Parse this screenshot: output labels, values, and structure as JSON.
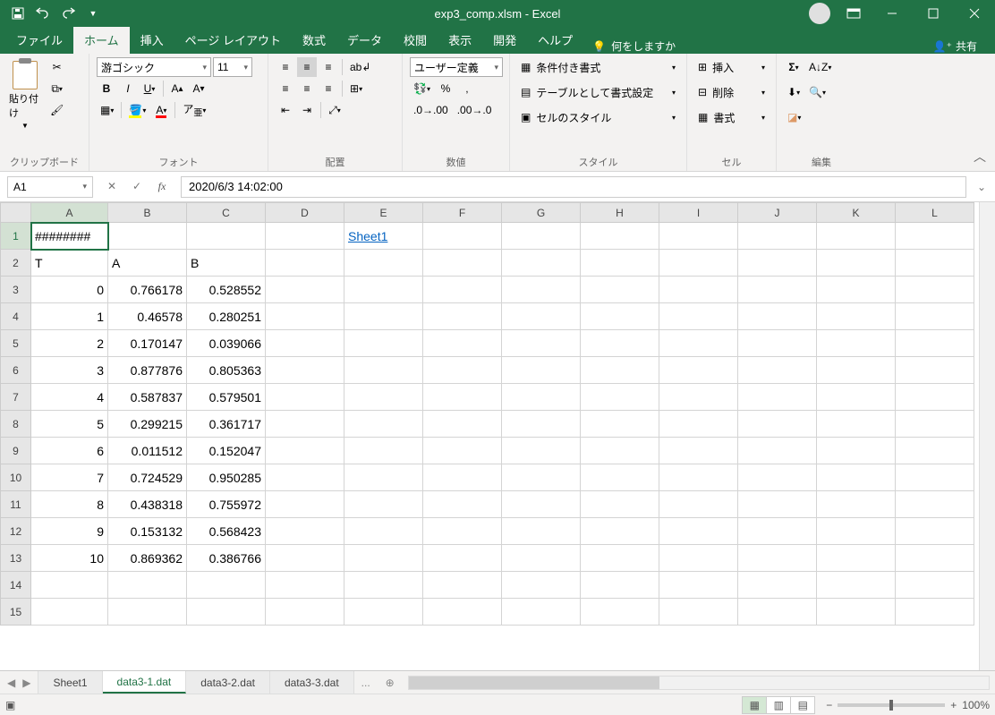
{
  "titlebar": {
    "title": "exp3_comp.xlsm  -  Excel"
  },
  "tabs": {
    "file": "ファイル",
    "home": "ホーム",
    "insert": "挿入",
    "pagelayout": "ページ レイアウト",
    "formulas": "数式",
    "data": "データ",
    "review": "校閲",
    "view": "表示",
    "developer": "開発",
    "help": "ヘルプ",
    "tellme": "何をしますか",
    "share": "共有"
  },
  "ribbon": {
    "clipboard": {
      "label": "クリップボード",
      "paste": "貼り付け"
    },
    "font": {
      "label": "フォント",
      "name": "游ゴシック",
      "size": "11"
    },
    "alignment": {
      "label": "配置"
    },
    "number": {
      "label": "数値",
      "format": "ユーザー定義"
    },
    "styles": {
      "label": "スタイル",
      "cond": "条件付き書式",
      "table": "テーブルとして書式設定",
      "cell": "セルのスタイル"
    },
    "cells": {
      "label": "セル",
      "insert": "挿入",
      "delete": "削除",
      "format": "書式"
    },
    "editing": {
      "label": "編集"
    }
  },
  "namebox": "A1",
  "formula": "2020/6/3 14:02:00",
  "columns": [
    "A",
    "B",
    "C",
    "D",
    "E",
    "F",
    "G",
    "H",
    "I",
    "J",
    "K",
    "L"
  ],
  "rows": [
    "1",
    "2",
    "3",
    "4",
    "5",
    "6",
    "7",
    "8",
    "9",
    "10",
    "11",
    "12",
    "13",
    "14",
    "15"
  ],
  "cells": {
    "A1": "########",
    "E1": "Sheet1",
    "A2": "T",
    "B2": "A",
    "C2": "B",
    "A3": "0",
    "B3": "0.766178",
    "C3": "0.528552",
    "A4": "1",
    "B4": "0.46578",
    "C4": "0.280251",
    "A5": "2",
    "B5": "0.170147",
    "C5": "0.039066",
    "A6": "3",
    "B6": "0.877876",
    "C6": "0.805363",
    "A7": "4",
    "B7": "0.587837",
    "C7": "0.579501",
    "A8": "5",
    "B8": "0.299215",
    "C8": "0.361717",
    "A9": "6",
    "B9": "0.011512",
    "C9": "0.152047",
    "A10": "7",
    "B10": "0.724529",
    "C10": "0.950285",
    "A11": "8",
    "B11": "0.438318",
    "C11": "0.755972",
    "A12": "9",
    "B12": "0.153132",
    "C12": "0.568423",
    "A13": "10",
    "B13": "0.869362",
    "C13": "0.386766"
  },
  "sheets": {
    "s1": "Sheet1",
    "s2": "data3-1.dat",
    "s3": "data3-2.dat",
    "s4": "data3-3.dat",
    "more": "..."
  },
  "status": {
    "zoom": "100%"
  }
}
